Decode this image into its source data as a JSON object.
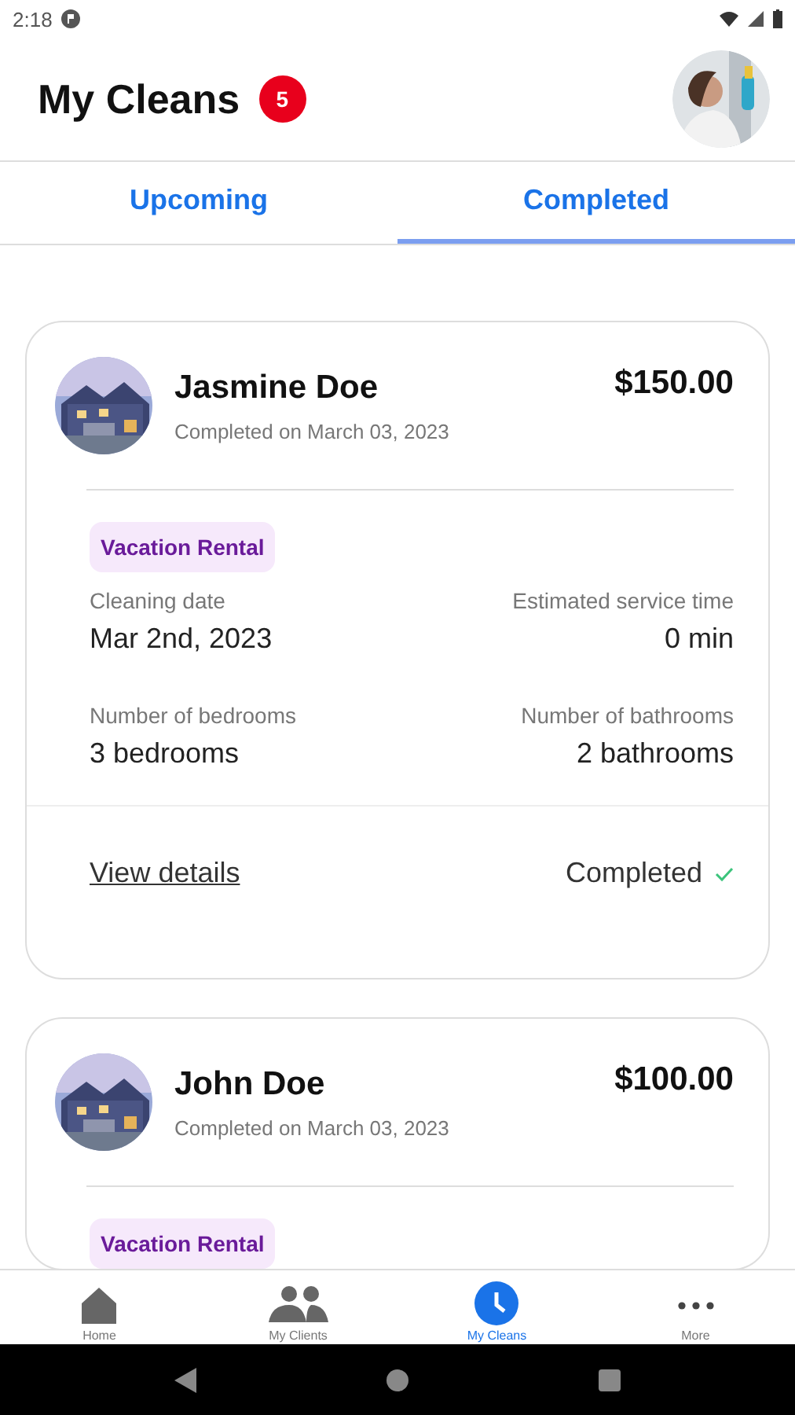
{
  "status_bar": {
    "time": "2:18"
  },
  "header": {
    "title": "My Cleans",
    "badge": "5"
  },
  "tabs": [
    {
      "label": "Upcoming",
      "selected": false
    },
    {
      "label": "Completed",
      "selected": true
    }
  ],
  "cleans": [
    {
      "name": "Jasmine Doe",
      "completed_on": "Completed on March 03, 2023",
      "price": "$150.00",
      "tag": "Vacation Rental",
      "details": [
        {
          "label": "Cleaning date",
          "value": "Mar 2nd, 2023"
        },
        {
          "label": "Estimated service time",
          "value": "0 min"
        },
        {
          "label": "Number of bedrooms",
          "value": "3 bedrooms"
        },
        {
          "label": "Number of bathrooms",
          "value": "2 bathrooms"
        }
      ],
      "link": "View details",
      "status": "Completed",
      "done": true
    },
    {
      "name": "John Doe",
      "completed_on": "Completed on March 03, 2023",
      "price": "$100.00",
      "tag": "Vacation Rental"
    }
  ],
  "bottom_nav": [
    {
      "label": "Home",
      "kind": "home",
      "selected": false
    },
    {
      "label": "My Clients",
      "kind": "clients",
      "selected": false
    },
    {
      "label": "My Cleans",
      "kind": "clock",
      "selected": true
    },
    {
      "label": "More",
      "kind": "more",
      "selected": false
    }
  ]
}
